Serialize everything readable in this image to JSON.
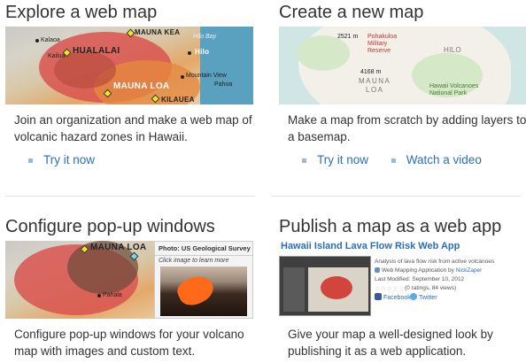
{
  "cards": [
    {
      "title": "Explore a web map",
      "description": "Join an organization and make a web map of volcanic hazard zones in Hawaii.",
      "links": [
        "Try it now"
      ],
      "map_labels": {
        "mauna_kea": "MAUNA KEA",
        "hualalai": "HUALALAI",
        "mauna_loa": "MAUNA LOA",
        "kilauea": "KILAUEA",
        "kalaoa": "Kalaoa",
        "kailua": "Kailua",
        "hilo_bay": "Hilo Bay",
        "hilo": "Hilo",
        "mountain_view": "Mountain View",
        "pahoa": "Pahoa"
      }
    },
    {
      "title": "Create a new map",
      "description": "Make a map from scratch by adding layers to a basemap.",
      "links": [
        "Try it now",
        "Watch a video"
      ],
      "map_labels": {
        "elev1": "2521 m",
        "military": "Pohakuloa Military Reserve",
        "hilo": "HILO",
        "elev2": "4168 m",
        "mauna": "MAUNA",
        "loa": "LOA",
        "hawaii": "Hawaii Volcanoes National Park"
      }
    },
    {
      "title": "Configure pop-up windows",
      "description": "Configure pop-up windows for your volcano map with images and custom text.",
      "links": [],
      "map_labels": {
        "mauna_loa": "MAUNA LOA",
        "pahala": "Pahala"
      },
      "popup": {
        "title": "Photo: US Geological Survey",
        "subtitle": "Click image to learn more"
      }
    },
    {
      "title": "Publish a map as a web app",
      "description": "Give your map a well-designed look by publishing it as a web application.",
      "links": [],
      "webapp": {
        "title": "Hawaii Island Lava Flow Risk Web App",
        "summary": "Analysis of lava flow risk from active volcanoes",
        "type_label": "Web Mapping Application by",
        "author": "NickZaper",
        "modified": "Last Modified: September 10, 2012",
        "rating": "(0 ratings, 84 views)",
        "facebook": "Facebook",
        "twitter": "Twitter"
      }
    }
  ],
  "colors": {
    "link": "#2a6ebb",
    "text": "#333333",
    "divider": "#e2e2e2"
  }
}
